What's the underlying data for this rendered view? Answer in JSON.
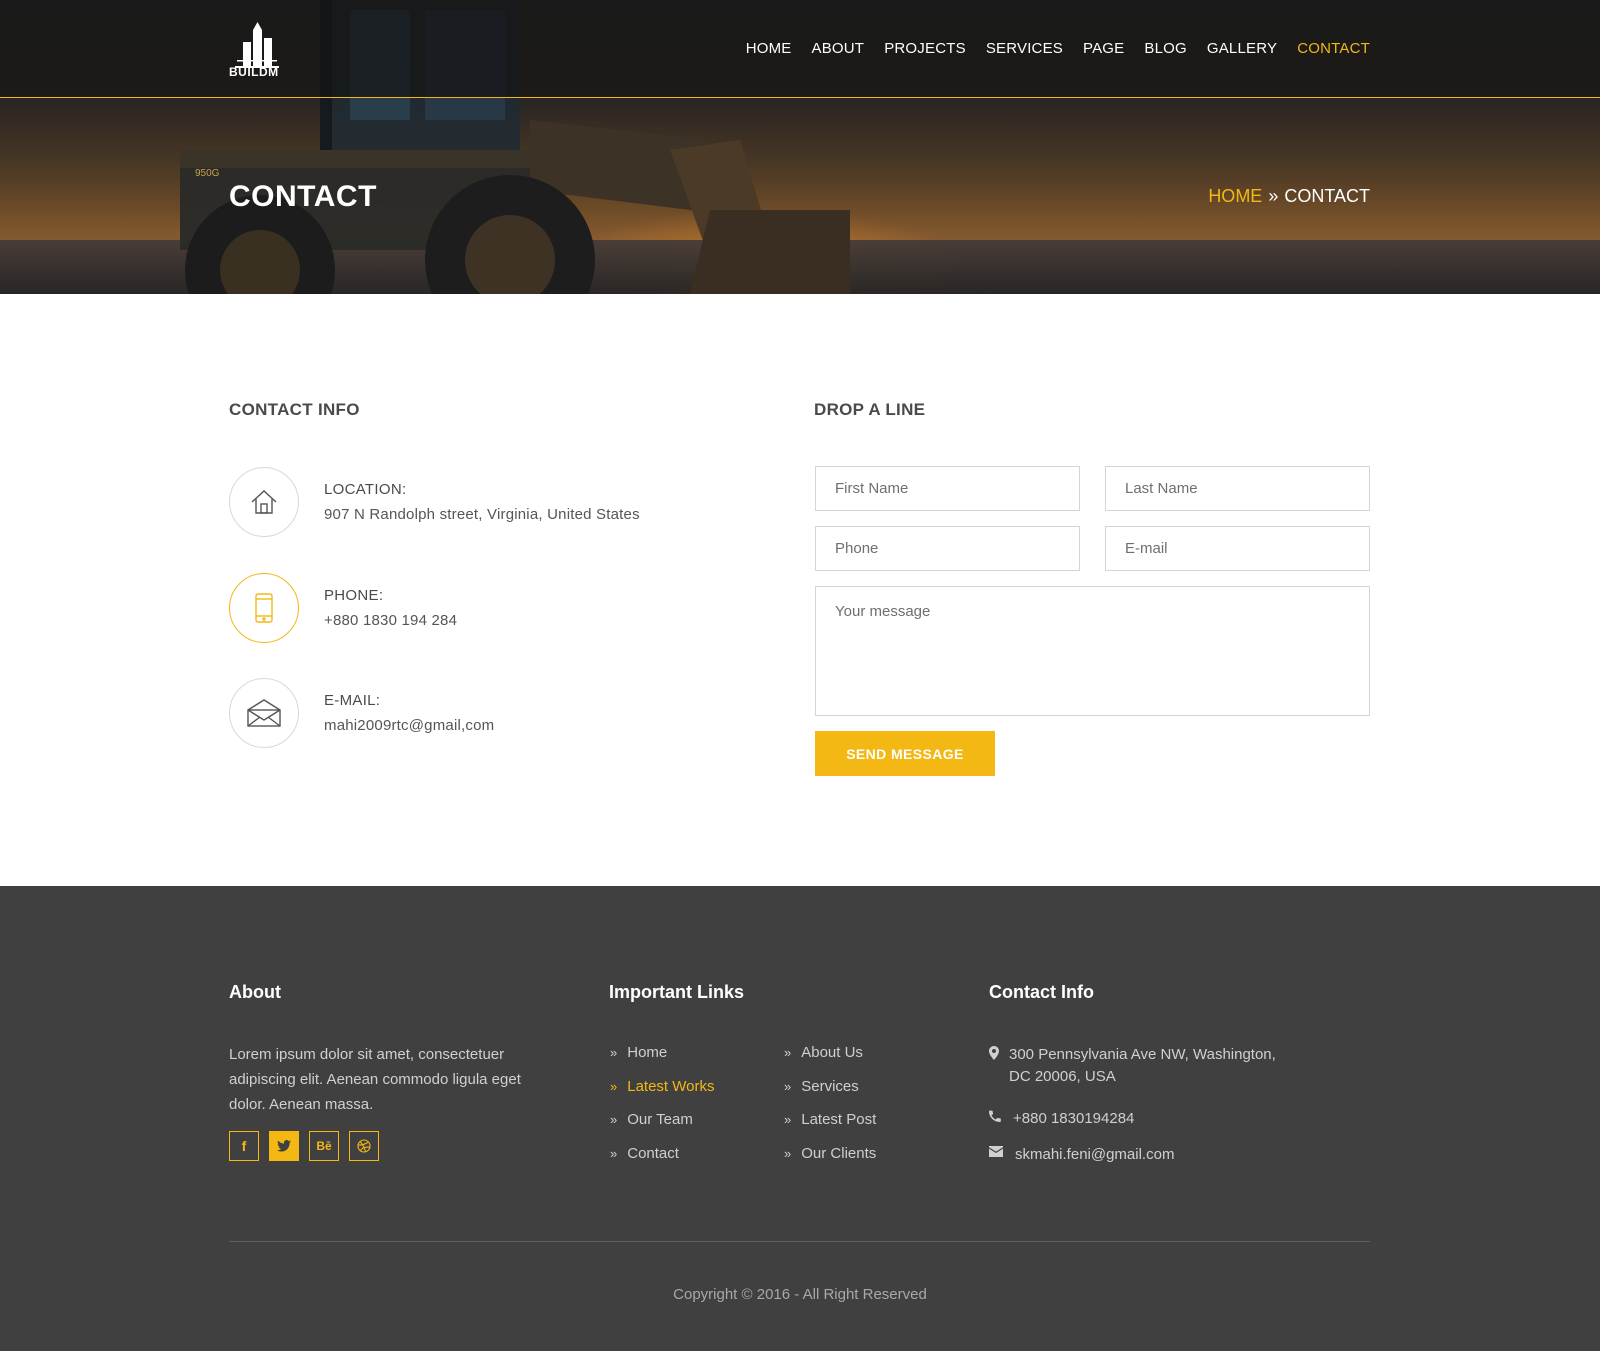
{
  "brand": {
    "name": "BUILDM"
  },
  "nav": {
    "items": [
      {
        "label": "HOME"
      },
      {
        "label": "ABOUT"
      },
      {
        "label": "PROJECTS"
      },
      {
        "label": "SERVICES"
      },
      {
        "label": "PAGE"
      },
      {
        "label": "BLOG"
      },
      {
        "label": "GALLERY"
      },
      {
        "label": "CONTACT",
        "active": true
      }
    ]
  },
  "banner": {
    "title": "CONTACT",
    "breadcrumb": {
      "home": "HOME",
      "separator": "»",
      "current": "CONTACT"
    },
    "machine_marking": "950G"
  },
  "contact_info": {
    "title": "CONTACT INFO",
    "items": [
      {
        "icon": "home-icon",
        "label": "LOCATION:",
        "value": "907 N Randolph street, Virginia, United States"
      },
      {
        "icon": "mobile-phone-icon",
        "label": "PHONE:",
        "value": "+880 1830 194 284"
      },
      {
        "icon": "envelope-icon",
        "label": "E-MAIL:",
        "value": "mahi2009rtc@gmail,com"
      }
    ]
  },
  "form": {
    "title": "DROP A LINE",
    "first_name_placeholder": "First Name",
    "last_name_placeholder": "Last Name",
    "phone_placeholder": "Phone",
    "email_placeholder": "E-mail",
    "message_placeholder": "Your message",
    "submit_label": "SEND MESSAGE"
  },
  "footer": {
    "about": {
      "title": "About",
      "text": "Lorem ipsum dolor sit amet, consectetuer adipiscing elit. Aenean commodo ligula eget dolor. Aenean massa.",
      "social": [
        {
          "icon": "facebook-icon",
          "glyph": "f"
        },
        {
          "icon": "twitter-icon",
          "glyph": ""
        },
        {
          "icon": "behance-icon",
          "glyph": "Bē"
        },
        {
          "icon": "dribbble-icon",
          "glyph": ""
        }
      ]
    },
    "links": {
      "title": "Important Links",
      "arrow": "»",
      "col1": [
        "Home",
        "Latest Works",
        "Our Team",
        "Contact"
      ],
      "col2": [
        "About Us",
        "Services",
        "Latest Post",
        "Our Clients"
      ],
      "active": "Latest Works"
    },
    "contact": {
      "title": "Contact Info",
      "address_line1": "300 Pennsylvania Ave NW, Washington,",
      "address_line2": "DC 20006, USA",
      "phone": "+880 1830194284",
      "email": "skmahi.feni@gmail.com"
    },
    "copyright": "Copyright © 2016 - All Right Reserved"
  },
  "colors": {
    "accent": "#f3b814",
    "footer_bg": "#404040",
    "text": "#4a4a4a"
  }
}
